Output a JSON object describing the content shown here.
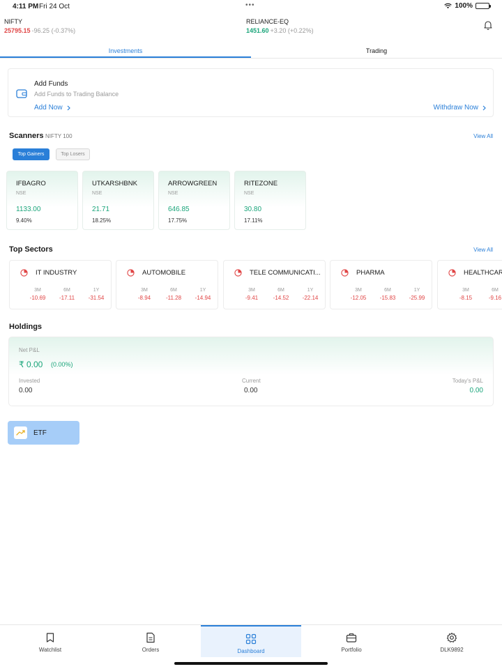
{
  "status_bar": {
    "time": "4:11 PM",
    "date": "Fri 24 Oct",
    "battery": "100%"
  },
  "tickers": [
    {
      "name": "NIFTY",
      "value": "25795.15",
      "change": "-96.25 (-0.37%)",
      "color": "#e04545"
    },
    {
      "name": "RELIANCE-EQ",
      "value": "1451.60",
      "change": "+3.20 (+0.22%)",
      "color": "#1aa57a"
    }
  ],
  "tabs": [
    {
      "label": "Investments",
      "active": true
    },
    {
      "label": "Trading",
      "active": false
    }
  ],
  "funds": {
    "title": "Add Funds",
    "subtitle": "Add Funds to Trading Balance",
    "add_now": "Add Now",
    "withdraw_now": "Withdraw Now"
  },
  "scanners": {
    "title": "Scanners",
    "index": "NIFTY 100",
    "view_all": "View All",
    "chips": [
      "Top Gainers",
      "Top Losers"
    ],
    "items": [
      {
        "name": "IFBAGRO",
        "exchange": "NSE",
        "price": "1133.00",
        "pct": "9.40%"
      },
      {
        "name": "UTKARSHBNK",
        "exchange": "NSE",
        "price": "21.71",
        "pct": "18.25%"
      },
      {
        "name": "ARROWGREEN",
        "exchange": "NSE",
        "price": "646.85",
        "pct": "17.75%"
      },
      {
        "name": "RITEZONE",
        "exchange": "NSE",
        "price": "30.80",
        "pct": "17.11%"
      }
    ]
  },
  "sectors": {
    "title": "Top Sectors",
    "view_all": "View All",
    "periods": [
      "3M",
      "6M",
      "1Y"
    ],
    "items": [
      {
        "name": "IT INDUSTRY",
        "values": [
          "-10.69",
          "-17.11",
          "-31.54"
        ]
      },
      {
        "name": "AUTOMOBILE",
        "values": [
          "-8.94",
          "-11.28",
          "-14.94"
        ]
      },
      {
        "name": "TELE COMMUNICATI...",
        "values": [
          "-9.41",
          "-14.52",
          "-22.14"
        ]
      },
      {
        "name": "PHARMA",
        "values": [
          "-12.05",
          "-15.83",
          "-25.99"
        ]
      },
      {
        "name": "HEALTHCARE",
        "values": [
          "-8.15",
          "-9.16",
          ""
        ]
      }
    ]
  },
  "holdings": {
    "title": "Holdings",
    "net_pl_label": "Net P&L",
    "net_pl_value": "₹ 0.00",
    "net_pl_pct": "(0.00%)",
    "invested_label": "Invested",
    "invested_value": "0.00",
    "current_label": "Current",
    "current_value": "0.00",
    "today_label": "Today's P&L",
    "today_value": "0.00"
  },
  "etf": {
    "label": "ETF"
  },
  "bottom_nav": [
    {
      "label": "Watchlist",
      "icon": "bookmark-icon"
    },
    {
      "label": "Orders",
      "icon": "document-icon"
    },
    {
      "label": "Dashboard",
      "icon": "grid-icon",
      "active": true
    },
    {
      "label": "Portfolio",
      "icon": "briefcase-icon"
    },
    {
      "label": "DLK9892",
      "icon": "gear-icon"
    }
  ],
  "colors": {
    "accent": "#2a7fd8",
    "positive": "#1aa57a",
    "negative": "#e04545"
  }
}
